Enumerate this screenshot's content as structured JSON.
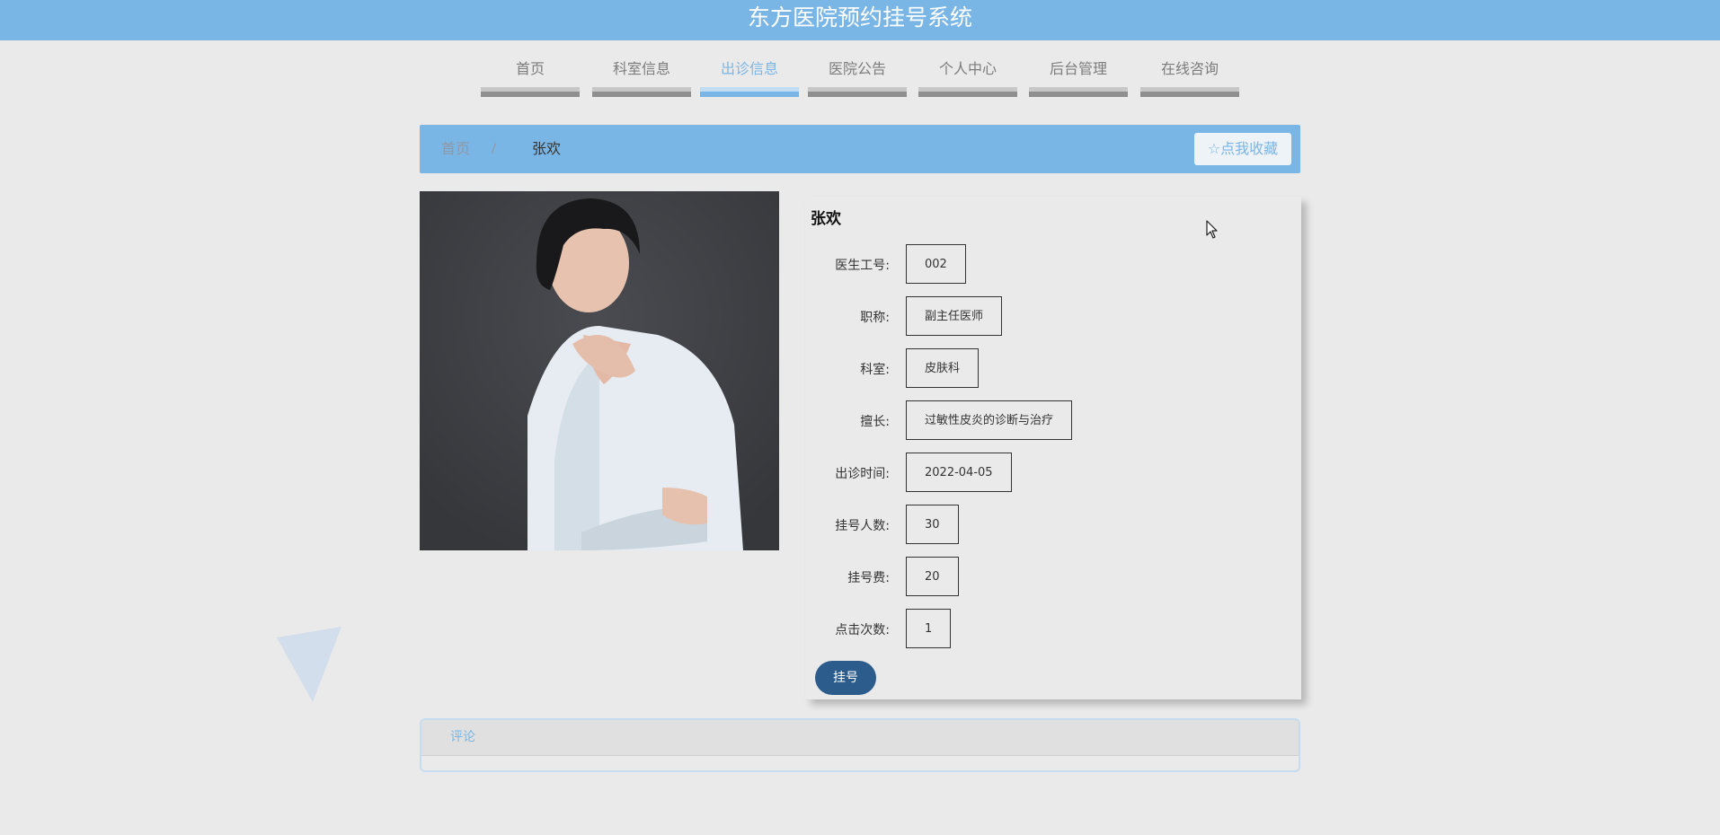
{
  "site": {
    "title": "东方医院预约挂号系统"
  },
  "nav": {
    "items": [
      {
        "label": "首页",
        "active": false
      },
      {
        "label": "科室信息",
        "active": false
      },
      {
        "label": "出诊信息",
        "active": true
      },
      {
        "label": "医院公告",
        "active": false
      },
      {
        "label": "个人中心",
        "active": false
      },
      {
        "label": "后台管理",
        "active": false
      },
      {
        "label": "在线咨询",
        "active": false
      }
    ]
  },
  "breadcrumb": {
    "home": "首页",
    "separator": "/",
    "current": "张欢"
  },
  "favorite": {
    "icon": "star-outline-icon",
    "label": "点我收藏"
  },
  "doctor": {
    "name": "张欢",
    "fields": [
      {
        "label": "医生工号:",
        "value": "002"
      },
      {
        "label": "职称:",
        "value": "副主任医师"
      },
      {
        "label": "科室:",
        "value": "皮肤科"
      },
      {
        "label": "擅长:",
        "value": "过敏性皮炎的诊断与治疗"
      },
      {
        "label": "出诊时间:",
        "value": "2022-04-05"
      },
      {
        "label": "挂号人数:",
        "value": "30"
      },
      {
        "label": "挂号费:",
        "value": "20"
      },
      {
        "label": "点击次数:",
        "value": "1"
      }
    ]
  },
  "actions": {
    "register_label": "挂号"
  },
  "comments": {
    "tab_label": "评论"
  },
  "colors": {
    "header_blue": "#7AB6E5",
    "page_bg": "#EBEAEB",
    "button_dark": "#2B5C8C",
    "nav_text": "#7C7C7C"
  }
}
